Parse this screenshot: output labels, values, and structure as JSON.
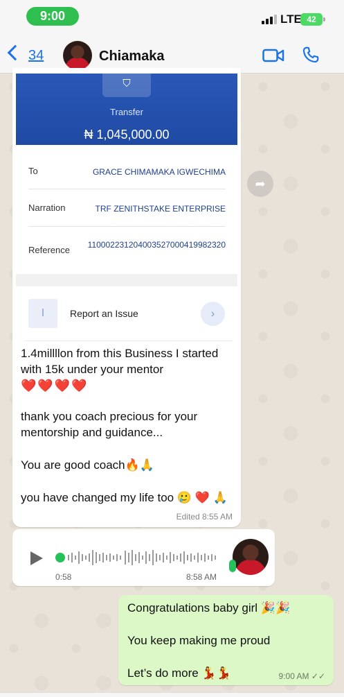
{
  "status_bar": {
    "time": "9:00",
    "network": "LTE",
    "battery": "42"
  },
  "header": {
    "back_count": "34",
    "contact_name": "Chiamaka"
  },
  "receipt": {
    "transfer_label": "Transfer",
    "amount": "₦ 1,045,000.00",
    "rows": [
      {
        "key": "To",
        "value": "GRACE CHIMAMAKA IGWECHIMA"
      },
      {
        "key": "Narration",
        "value": "TRF ZENITHSTAKE ENTERPRISE"
      },
      {
        "key": "Reference",
        "value": "110002231204003527000419982320"
      }
    ],
    "report_issue": "Report an Issue"
  },
  "message_in": {
    "line1": "1.4millllon   from this Business I started with 15k under your mentor",
    "hearts": "❤️❤️❤️❤️",
    "line2": "thank you coach precious for your mentorship and guidance...",
    "line3": "You are good coach🔥🙏",
    "line4": "you have changed my life too 🥲 ❤️ 🙏",
    "meta": "Edited 8:55 AM"
  },
  "voice": {
    "duration": "0:58",
    "time": "8:58 AM"
  },
  "message_out": {
    "line1": "Congratulations baby girl 🎉🎉",
    "line2": "You keep making me proud",
    "line3": "Let’s do more 💃💃",
    "time": "9:00 AM ✓✓"
  },
  "colors": {
    "accent": "#1a73e8",
    "outgoing_bubble": "#dcf8c6",
    "receipt_blue": "#2a58b8",
    "status_pill": "#2fbf4f"
  }
}
